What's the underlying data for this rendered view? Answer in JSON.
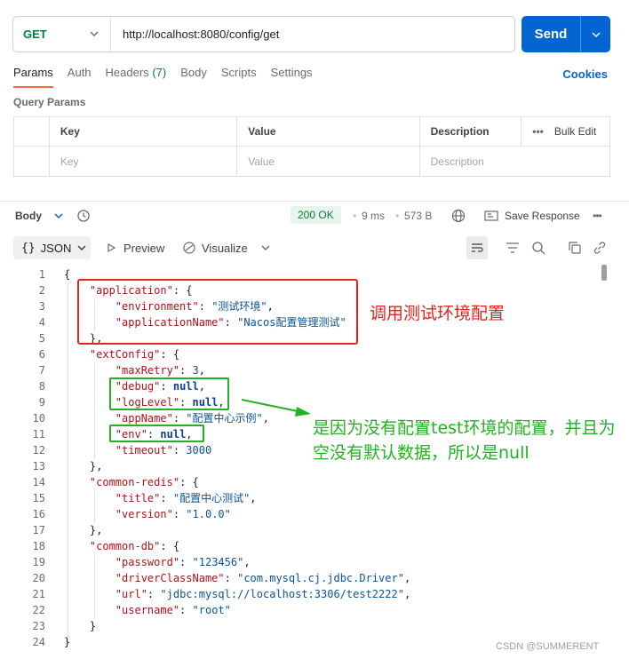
{
  "request": {
    "method": "GET",
    "url": "http://localhost:8080/config/get",
    "send_label": "Send"
  },
  "tabs": [
    {
      "label": "Params"
    },
    {
      "label": "Auth"
    },
    {
      "label": "Headers",
      "count": "(7)"
    },
    {
      "label": "Body"
    },
    {
      "label": "Scripts"
    },
    {
      "label": "Settings"
    }
  ],
  "cookies_label": "Cookies",
  "query_params": {
    "title": "Query Params",
    "headers": [
      "Key",
      "Value",
      "Description"
    ],
    "bulk_edit": "Bulk Edit",
    "placeholders": [
      "Key",
      "Value",
      "Description"
    ]
  },
  "response": {
    "body_label": "Body",
    "status": "200 OK",
    "time": "9 ms",
    "size": "573 B",
    "save_label": "Save Response"
  },
  "view": {
    "format": "JSON",
    "preview_label": "Preview",
    "visualize_label": "Visualize"
  },
  "code_lines": [
    "{",
    "    \"application\": {",
    "        \"environment\": \"测试环境\",",
    "        \"applicationName\": \"Nacos配置管理测试\"",
    "    },",
    "    \"extConfig\": {",
    "        \"maxRetry\": 3,",
    "        \"debug\": null,",
    "        \"logLevel\": null,",
    "        \"appName\": \"配置中心示例\",",
    "        \"env\": null,",
    "        \"timeout\": 3000",
    "    },",
    "    \"common-redis\": {",
    "        \"title\": \"配置中心测试\",",
    "        \"version\": \"1.0.0\"",
    "    },",
    "    \"common-db\": {",
    "        \"password\": \"123456\",",
    "        \"driverClassName\": \"com.mysql.cj.jdbc.Driver\",",
    "        \"url\": \"jdbc:mysql://localhost:3306/test2222\",",
    "        \"username\": \"root\"",
    "    }",
    "}"
  ],
  "annotations": {
    "red_note": "调用测试环境配置",
    "green_note": "是因为没有配置test环境的配置，并且为空没有默认数据，所以是null"
  },
  "watermark": "CSDN @SUMMERENT"
}
